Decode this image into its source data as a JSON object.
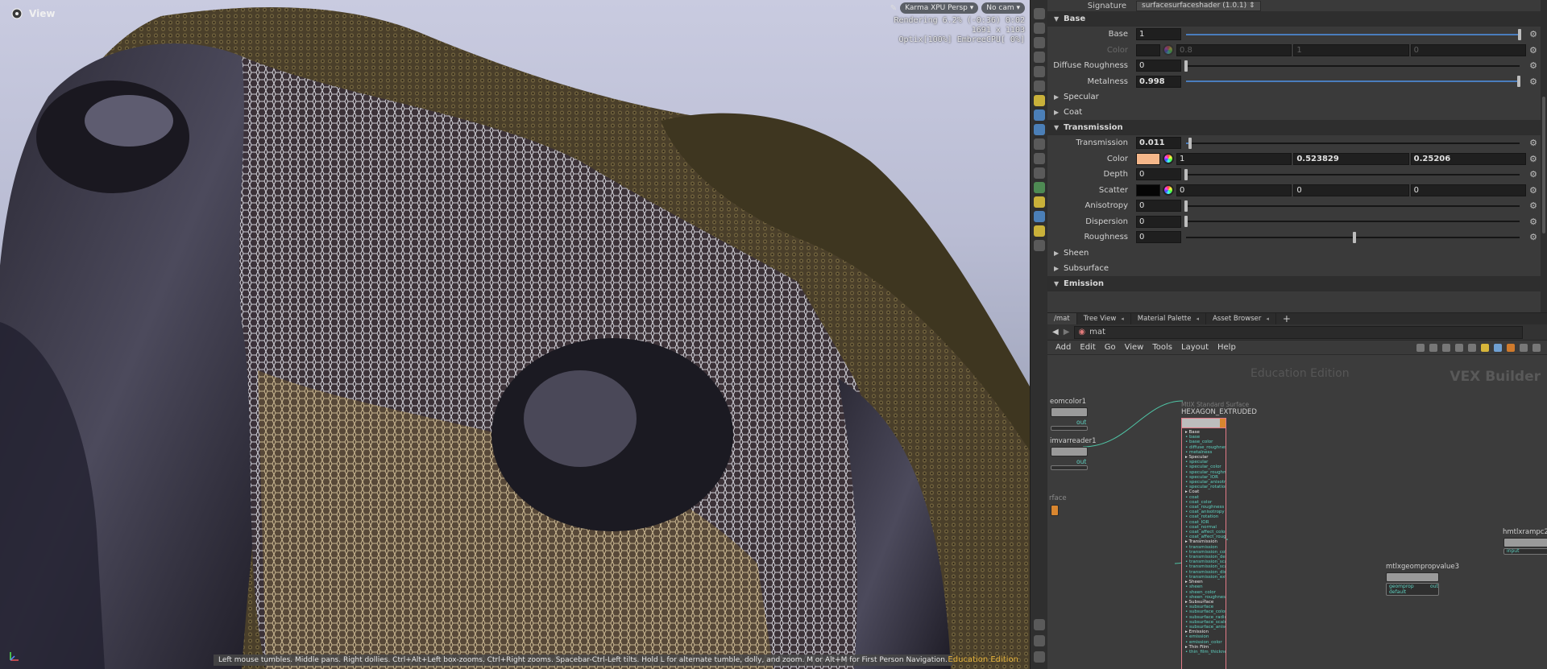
{
  "viewport": {
    "title": "View",
    "renderer_pill": "Karma XPU  Persp",
    "camera_pill": "No cam",
    "render_info": [
      "Rendering  6.2%  (-0:36)  0:02",
      "1691 x 1103",
      "Optix[100%] EmbreeCPU[  0%]"
    ],
    "status_bar": "Left mouse tumbles. Middle pans. Right dollies. Ctrl+Alt+Left box-zooms. Ctrl+Right zooms. Spacebar-Ctrl-Left tilts. Hold L for alternate tumble, dolly, and zoom.  M or Alt+M for First Person Navigation.",
    "edition_badge": "Education Edition"
  },
  "params": {
    "signature_label": "Signature",
    "signature_value": "surfacesurfaceshader (1.0.1)",
    "sections": {
      "base": "Base",
      "specular": "Specular",
      "coat": "Coat",
      "transmission": "Transmission",
      "sheen": "Sheen",
      "subsurface": "Subsurface",
      "emission": "Emission"
    },
    "base_rows": [
      {
        "label": "Base",
        "value": "1",
        "slider": 1.0
      },
      {
        "label": "Color",
        "values": [
          "0.8",
          "1",
          "0"
        ]
      },
      {
        "label": "Diffuse Roughness",
        "value": "0",
        "slider": 0.0
      },
      {
        "label": "Metalness",
        "value": "0.998",
        "slider": 0.998
      }
    ],
    "transmission_rows": [
      {
        "label": "Transmission",
        "value": "0.011",
        "slider": 0.011
      },
      {
        "label": "Color",
        "swatch": "#f5b78a",
        "values": [
          "1",
          "0.523829",
          "0.25206"
        ]
      },
      {
        "label": "Depth",
        "value": "0",
        "slider": 0.0
      },
      {
        "label": "Scatter",
        "swatch": "#050505",
        "values": [
          "0",
          "0",
          "0"
        ]
      },
      {
        "label": "Anisotropy",
        "value": "0",
        "slider": 0.0
      },
      {
        "label": "Dispersion",
        "value": "0",
        "slider": 0.0
      },
      {
        "label": "Roughness",
        "value": "0",
        "slider": 0.0
      }
    ]
  },
  "network": {
    "tabs": [
      "/mat",
      "Tree View",
      "Material Palette",
      "Asset Browser"
    ],
    "path": "mat",
    "menu": [
      "Add",
      "Edit",
      "Go",
      "View",
      "Tools",
      "Layout",
      "Help"
    ],
    "watermark_edition": "Education Edition",
    "watermark_context": "VEX Builder",
    "nodes": {
      "main_title": "HEXAGON_EXTRUDED",
      "main_subtitle": "MtlX Standard Surface",
      "geomcolor": "eomcolor1",
      "geomcolor_port": "out",
      "primvar": "imvarreader1",
      "primvar_port": "out",
      "surface": "rface",
      "geomprop": "mtlxgeompropvalue3",
      "geomprop_ports": [
        "geomprop",
        "default"
      ],
      "geomprop_out": "out",
      "ramp": "hmtlxrampc2",
      "ramp_port": "input"
    },
    "ports": [
      {
        "group": "Base",
        "items": [
          "base",
          "base_color",
          "diffuse_roughness",
          "metalness"
        ]
      },
      {
        "group": "Specular",
        "items": [
          "specular",
          "specular_color",
          "specular_roughness",
          "specular_IOR",
          "specular_anisotropy",
          "specular_rotation"
        ]
      },
      {
        "group": "Coat",
        "items": [
          "coat",
          "coat_color",
          "coat_roughness",
          "coat_anisotropy",
          "coat_rotation",
          "coat_IOR",
          "coat_normal",
          "coat_affect_color",
          "coat_affect_roughness"
        ]
      },
      {
        "group": "Transmission",
        "items": [
          "transmission",
          "transmission_color",
          "transmission_depth",
          "transmission_scatter",
          "transmission_scatter_ani...",
          "transmission_dispersion",
          "transmission_extra_roug..."
        ]
      },
      {
        "group": "Sheen",
        "items": [
          "sheen",
          "sheen_color",
          "sheen_roughness"
        ]
      },
      {
        "group": "Subsurface",
        "items": [
          "subsurface",
          "subsurface_color",
          "subsurface_radius",
          "subsurface_scale",
          "subsurface_anisotropy"
        ]
      },
      {
        "group": "Emission",
        "items": [
          "emission",
          "emission_color"
        ]
      },
      {
        "group": "Thin Film",
        "items": [
          "thin_film_thickness"
        ]
      }
    ]
  },
  "colors": {
    "accent_blue": "#4a7dbd",
    "node_highlight": "#e27a87",
    "wire": "#4fc5a6",
    "edition_yellow": "#e5b23a"
  }
}
